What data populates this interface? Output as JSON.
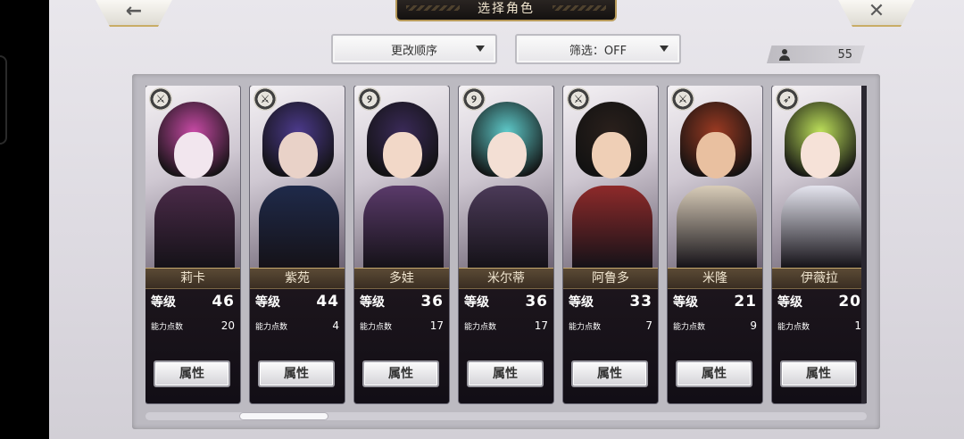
{
  "header": {
    "title": "选择角色",
    "back_icon": "←",
    "close_icon": "✕"
  },
  "toolbar": {
    "sort_label": "更改顺序",
    "filter_label": "筛选：OFF",
    "character_count": "55"
  },
  "card_labels": {
    "level_label": "等级",
    "ability_points_label": "能力点数",
    "attribute_button_label": "属性"
  },
  "characters": [
    {
      "name": "莉卡",
      "level": "46",
      "ability_points": "20",
      "weapon": "sword",
      "badge": "⚔",
      "colors": {
        "hair": "#c74aa5",
        "face": "#f2e6ee",
        "body": "#4a2a48"
      }
    },
    {
      "name": "紫苑",
      "level": "44",
      "ability_points": "4",
      "weapon": "sword",
      "badge": "⚔",
      "colors": {
        "hair": "#4c3a8c",
        "face": "#e9d2c8",
        "body": "#1f2a4a"
      }
    },
    {
      "name": "多娃",
      "level": "36",
      "ability_points": "17",
      "weapon": "staff",
      "badge": "୨",
      "colors": {
        "hair": "#3a2a58",
        "face": "#f2d8c8",
        "body": "#5a3a6a"
      }
    },
    {
      "name": "米尔蒂",
      "level": "36",
      "ability_points": "17",
      "weapon": "staff",
      "badge": "୨",
      "colors": {
        "hair": "#5ec9c9",
        "face": "#f3dfd4",
        "body": "#4b3a58"
      }
    },
    {
      "name": "阿鲁多",
      "level": "33",
      "ability_points": "7",
      "weapon": "sword",
      "badge": "⚔",
      "colors": {
        "hair": "#2a201c",
        "face": "#efcfb6",
        "body": "#8e2a2a"
      }
    },
    {
      "name": "米隆",
      "level": "21",
      "ability_points": "9",
      "weapon": "sword",
      "badge": "⚔",
      "colors": {
        "hair": "#9b3a22",
        "face": "#e9c0a0",
        "body": "#d8ccb8"
      }
    },
    {
      "name": "伊薇拉",
      "level": "20",
      "ability_points": "1",
      "weapon": "spear",
      "badge": "➶",
      "colors": {
        "hair": "#bde05a",
        "face": "#f6e2d8",
        "body": "#e4e4ee"
      }
    }
  ]
}
